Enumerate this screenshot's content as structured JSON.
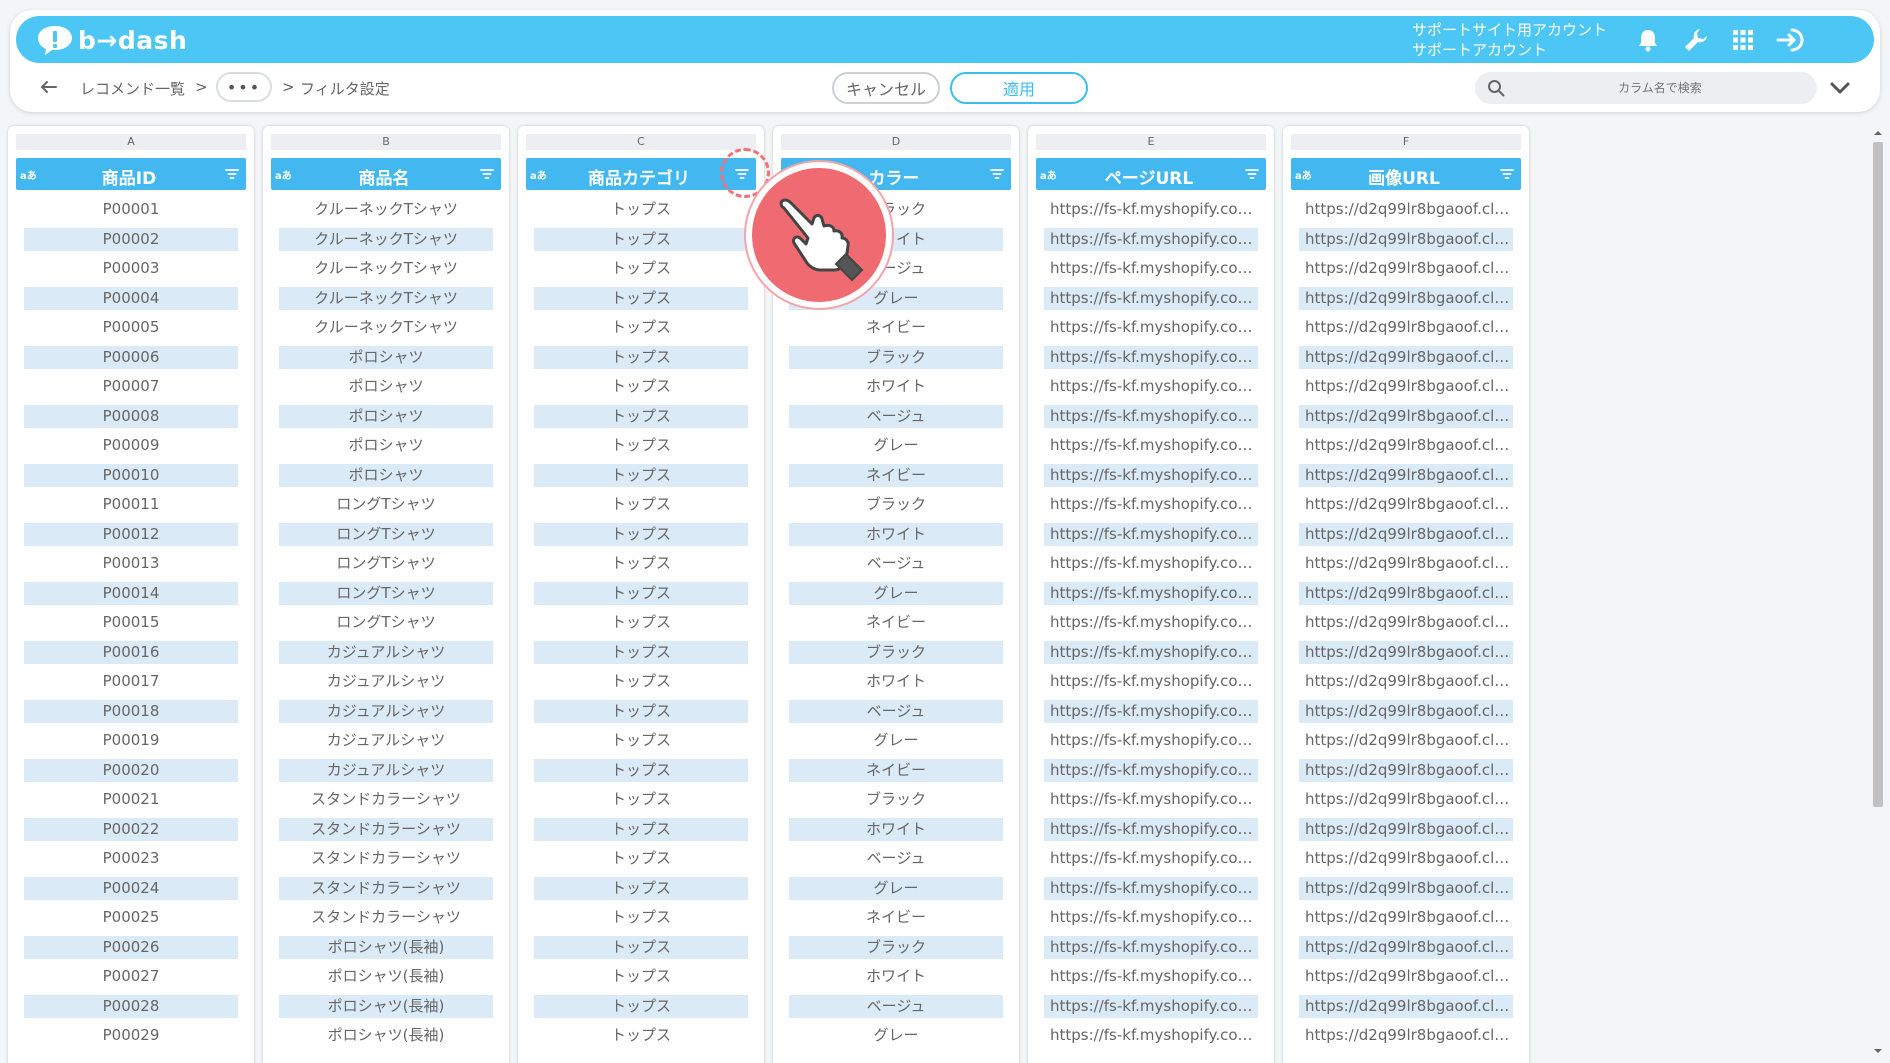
{
  "header": {
    "logo_text": "b→dash",
    "account_line1": "サポートサイト用アカウント",
    "account_line2": "サポートアカウント",
    "icons": [
      "bell-icon",
      "wrench-icon",
      "grid-icon",
      "logout-icon"
    ],
    "accent_color": "#4cc6f4"
  },
  "breadcrumb": {
    "item1": "レコメンド一覧",
    "sep1": ">",
    "ellipsis": "•••",
    "sep2": ">",
    "current": "フィルタ設定"
  },
  "actions": {
    "cancel_label": "キャンセル",
    "apply_label": "適用"
  },
  "search": {
    "placeholder": "カラム名で検索"
  },
  "columns": [
    {
      "letter": "A",
      "title": "商品ID",
      "type_icon": "aあ",
      "kind": "text"
    },
    {
      "letter": "B",
      "title": "商品名",
      "type_icon": "aあ",
      "kind": "text"
    },
    {
      "letter": "C",
      "title": "商品カテゴリ",
      "type_icon": "aあ",
      "kind": "text"
    },
    {
      "letter": "D",
      "title": "カラー",
      "type_icon": "aあ",
      "kind": "text"
    },
    {
      "letter": "E",
      "title": "ページURL",
      "type_icon": "aあ",
      "kind": "url"
    },
    {
      "letter": "F",
      "title": "画像URL",
      "type_icon": "aあ",
      "kind": "url"
    }
  ],
  "rows": [
    [
      "P00001",
      "クルーネックTシャツ",
      "トップス",
      "ブラック",
      "https://fs-kf.myshopify.com…",
      "https://d2q99lr8bgaoof.clo…"
    ],
    [
      "P00002",
      "クルーネックTシャツ",
      "トップス",
      "ホワイト",
      "https://fs-kf.myshopify.com…",
      "https://d2q99lr8bgaoof.clo…"
    ],
    [
      "P00003",
      "クルーネックTシャツ",
      "トップス",
      "ベージュ",
      "https://fs-kf.myshopify.com…",
      "https://d2q99lr8bgaoof.clo…"
    ],
    [
      "P00004",
      "クルーネックTシャツ",
      "トップス",
      "グレー",
      "https://fs-kf.myshopify.com…",
      "https://d2q99lr8bgaoof.clo…"
    ],
    [
      "P00005",
      "クルーネックTシャツ",
      "トップス",
      "ネイビー",
      "https://fs-kf.myshopify.com…",
      "https://d2q99lr8bgaoof.clo…"
    ],
    [
      "P00006",
      "ポロシャツ",
      "トップス",
      "ブラック",
      "https://fs-kf.myshopify.com…",
      "https://d2q99lr8bgaoof.clo…"
    ],
    [
      "P00007",
      "ポロシャツ",
      "トップス",
      "ホワイト",
      "https://fs-kf.myshopify.com…",
      "https://d2q99lr8bgaoof.clo…"
    ],
    [
      "P00008",
      "ポロシャツ",
      "トップス",
      "ベージュ",
      "https://fs-kf.myshopify.com…",
      "https://d2q99lr8bgaoof.clo…"
    ],
    [
      "P00009",
      "ポロシャツ",
      "トップス",
      "グレー",
      "https://fs-kf.myshopify.com…",
      "https://d2q99lr8bgaoof.clo…"
    ],
    [
      "P00010",
      "ポロシャツ",
      "トップス",
      "ネイビー",
      "https://fs-kf.myshopify.com…",
      "https://d2q99lr8bgaoof.clo…"
    ],
    [
      "P00011",
      "ロングTシャツ",
      "トップス",
      "ブラック",
      "https://fs-kf.myshopify.com…",
      "https://d2q99lr8bgaoof.clo…"
    ],
    [
      "P00012",
      "ロングTシャツ",
      "トップス",
      "ホワイト",
      "https://fs-kf.myshopify.com…",
      "https://d2q99lr8bgaoof.clo…"
    ],
    [
      "P00013",
      "ロングTシャツ",
      "トップス",
      "ベージュ",
      "https://fs-kf.myshopify.com…",
      "https://d2q99lr8bgaoof.clo…"
    ],
    [
      "P00014",
      "ロングTシャツ",
      "トップス",
      "グレー",
      "https://fs-kf.myshopify.com…",
      "https://d2q99lr8bgaoof.clo…"
    ],
    [
      "P00015",
      "ロングTシャツ",
      "トップス",
      "ネイビー",
      "https://fs-kf.myshopify.com…",
      "https://d2q99lr8bgaoof.clo…"
    ],
    [
      "P00016",
      "カジュアルシャツ",
      "トップス",
      "ブラック",
      "https://fs-kf.myshopify.com…",
      "https://d2q99lr8bgaoof.clo…"
    ],
    [
      "P00017",
      "カジュアルシャツ",
      "トップス",
      "ホワイト",
      "https://fs-kf.myshopify.com…",
      "https://d2q99lr8bgaoof.clo…"
    ],
    [
      "P00018",
      "カジュアルシャツ",
      "トップス",
      "ベージュ",
      "https://fs-kf.myshopify.com…",
      "https://d2q99lr8bgaoof.clo…"
    ],
    [
      "P00019",
      "カジュアルシャツ",
      "トップス",
      "グレー",
      "https://fs-kf.myshopify.com…",
      "https://d2q99lr8bgaoof.clo…"
    ],
    [
      "P00020",
      "カジュアルシャツ",
      "トップス",
      "ネイビー",
      "https://fs-kf.myshopify.com…",
      "https://d2q99lr8bgaoof.clo…"
    ],
    [
      "P00021",
      "スタンドカラーシャツ",
      "トップス",
      "ブラック",
      "https://fs-kf.myshopify.com…",
      "https://d2q99lr8bgaoof.clo…"
    ],
    [
      "P00022",
      "スタンドカラーシャツ",
      "トップス",
      "ホワイト",
      "https://fs-kf.myshopify.com…",
      "https://d2q99lr8bgaoof.clo…"
    ],
    [
      "P00023",
      "スタンドカラーシャツ",
      "トップス",
      "ベージュ",
      "https://fs-kf.myshopify.com…",
      "https://d2q99lr8bgaoof.clo…"
    ],
    [
      "P00024",
      "スタンドカラーシャツ",
      "トップス",
      "グレー",
      "https://fs-kf.myshopify.com…",
      "https://d2q99lr8bgaoof.clo…"
    ],
    [
      "P00025",
      "スタンドカラーシャツ",
      "トップス",
      "ネイビー",
      "https://fs-kf.myshopify.com…",
      "https://d2q99lr8bgaoof.clo…"
    ],
    [
      "P00026",
      "ポロシャツ(長袖)",
      "トップス",
      "ブラック",
      "https://fs-kf.myshopify.com…",
      "https://d2q99lr8bgaoof.clo…"
    ],
    [
      "P00027",
      "ポロシャツ(長袖)",
      "トップス",
      "ホワイト",
      "https://fs-kf.myshopify.com…",
      "https://d2q99lr8bgaoof.clo…"
    ],
    [
      "P00028",
      "ポロシャツ(長袖)",
      "トップス",
      "ベージュ",
      "https://fs-kf.myshopify.com…",
      "https://d2q99lr8bgaoof.clo…"
    ],
    [
      "P00029",
      "ポロシャツ(長袖)",
      "トップス",
      "グレー",
      "https://fs-kf.myshopify.com…",
      "https://d2q99lr8bgaoof.clo…"
    ]
  ],
  "overlay": {
    "highlight_target": "filter-icon-c",
    "pointer_icon": "hand-pointer-icon"
  }
}
